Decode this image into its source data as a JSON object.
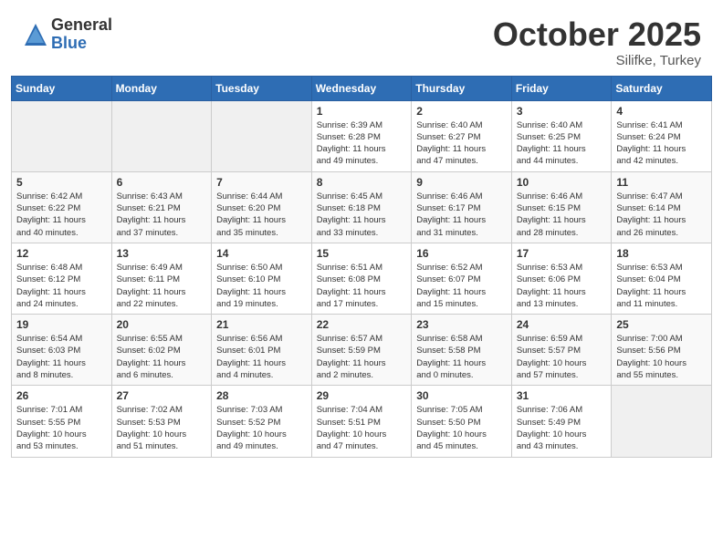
{
  "logo": {
    "general": "General",
    "blue": "Blue"
  },
  "title": {
    "month": "October 2025",
    "location": "Silifke, Turkey"
  },
  "weekdays": [
    "Sunday",
    "Monday",
    "Tuesday",
    "Wednesday",
    "Thursday",
    "Friday",
    "Saturday"
  ],
  "weeks": [
    [
      {
        "day": "",
        "info": ""
      },
      {
        "day": "",
        "info": ""
      },
      {
        "day": "",
        "info": ""
      },
      {
        "day": "1",
        "info": "Sunrise: 6:39 AM\nSunset: 6:28 PM\nDaylight: 11 hours\nand 49 minutes."
      },
      {
        "day": "2",
        "info": "Sunrise: 6:40 AM\nSunset: 6:27 PM\nDaylight: 11 hours\nand 47 minutes."
      },
      {
        "day": "3",
        "info": "Sunrise: 6:40 AM\nSunset: 6:25 PM\nDaylight: 11 hours\nand 44 minutes."
      },
      {
        "day": "4",
        "info": "Sunrise: 6:41 AM\nSunset: 6:24 PM\nDaylight: 11 hours\nand 42 minutes."
      }
    ],
    [
      {
        "day": "5",
        "info": "Sunrise: 6:42 AM\nSunset: 6:22 PM\nDaylight: 11 hours\nand 40 minutes."
      },
      {
        "day": "6",
        "info": "Sunrise: 6:43 AM\nSunset: 6:21 PM\nDaylight: 11 hours\nand 37 minutes."
      },
      {
        "day": "7",
        "info": "Sunrise: 6:44 AM\nSunset: 6:20 PM\nDaylight: 11 hours\nand 35 minutes."
      },
      {
        "day": "8",
        "info": "Sunrise: 6:45 AM\nSunset: 6:18 PM\nDaylight: 11 hours\nand 33 minutes."
      },
      {
        "day": "9",
        "info": "Sunrise: 6:46 AM\nSunset: 6:17 PM\nDaylight: 11 hours\nand 31 minutes."
      },
      {
        "day": "10",
        "info": "Sunrise: 6:46 AM\nSunset: 6:15 PM\nDaylight: 11 hours\nand 28 minutes."
      },
      {
        "day": "11",
        "info": "Sunrise: 6:47 AM\nSunset: 6:14 PM\nDaylight: 11 hours\nand 26 minutes."
      }
    ],
    [
      {
        "day": "12",
        "info": "Sunrise: 6:48 AM\nSunset: 6:12 PM\nDaylight: 11 hours\nand 24 minutes."
      },
      {
        "day": "13",
        "info": "Sunrise: 6:49 AM\nSunset: 6:11 PM\nDaylight: 11 hours\nand 22 minutes."
      },
      {
        "day": "14",
        "info": "Sunrise: 6:50 AM\nSunset: 6:10 PM\nDaylight: 11 hours\nand 19 minutes."
      },
      {
        "day": "15",
        "info": "Sunrise: 6:51 AM\nSunset: 6:08 PM\nDaylight: 11 hours\nand 17 minutes."
      },
      {
        "day": "16",
        "info": "Sunrise: 6:52 AM\nSunset: 6:07 PM\nDaylight: 11 hours\nand 15 minutes."
      },
      {
        "day": "17",
        "info": "Sunrise: 6:53 AM\nSunset: 6:06 PM\nDaylight: 11 hours\nand 13 minutes."
      },
      {
        "day": "18",
        "info": "Sunrise: 6:53 AM\nSunset: 6:04 PM\nDaylight: 11 hours\nand 11 minutes."
      }
    ],
    [
      {
        "day": "19",
        "info": "Sunrise: 6:54 AM\nSunset: 6:03 PM\nDaylight: 11 hours\nand 8 minutes."
      },
      {
        "day": "20",
        "info": "Sunrise: 6:55 AM\nSunset: 6:02 PM\nDaylight: 11 hours\nand 6 minutes."
      },
      {
        "day": "21",
        "info": "Sunrise: 6:56 AM\nSunset: 6:01 PM\nDaylight: 11 hours\nand 4 minutes."
      },
      {
        "day": "22",
        "info": "Sunrise: 6:57 AM\nSunset: 5:59 PM\nDaylight: 11 hours\nand 2 minutes."
      },
      {
        "day": "23",
        "info": "Sunrise: 6:58 AM\nSunset: 5:58 PM\nDaylight: 11 hours\nand 0 minutes."
      },
      {
        "day": "24",
        "info": "Sunrise: 6:59 AM\nSunset: 5:57 PM\nDaylight: 10 hours\nand 57 minutes."
      },
      {
        "day": "25",
        "info": "Sunrise: 7:00 AM\nSunset: 5:56 PM\nDaylight: 10 hours\nand 55 minutes."
      }
    ],
    [
      {
        "day": "26",
        "info": "Sunrise: 7:01 AM\nSunset: 5:55 PM\nDaylight: 10 hours\nand 53 minutes."
      },
      {
        "day": "27",
        "info": "Sunrise: 7:02 AM\nSunset: 5:53 PM\nDaylight: 10 hours\nand 51 minutes."
      },
      {
        "day": "28",
        "info": "Sunrise: 7:03 AM\nSunset: 5:52 PM\nDaylight: 10 hours\nand 49 minutes."
      },
      {
        "day": "29",
        "info": "Sunrise: 7:04 AM\nSunset: 5:51 PM\nDaylight: 10 hours\nand 47 minutes."
      },
      {
        "day": "30",
        "info": "Sunrise: 7:05 AM\nSunset: 5:50 PM\nDaylight: 10 hours\nand 45 minutes."
      },
      {
        "day": "31",
        "info": "Sunrise: 7:06 AM\nSunset: 5:49 PM\nDaylight: 10 hours\nand 43 minutes."
      },
      {
        "day": "",
        "info": ""
      }
    ]
  ]
}
